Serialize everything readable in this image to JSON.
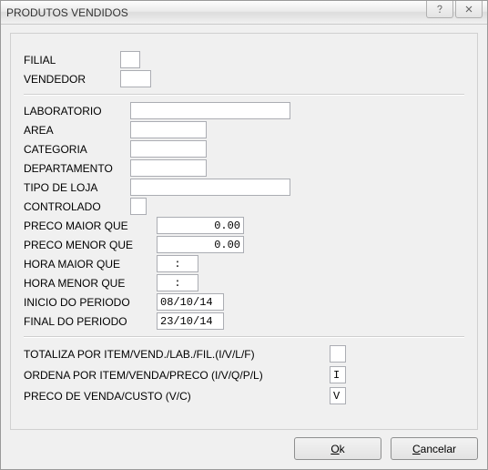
{
  "title": "PRODUTOS VENDIDOS",
  "section1": {
    "filial_label": "FILIAL",
    "filial_value": "",
    "vendedor_label": "VENDEDOR",
    "vendedor_value": ""
  },
  "section2": {
    "laboratorio_label": "LABORATORIO",
    "laboratorio_value": "",
    "area_label": "AREA",
    "area_value": "",
    "categoria_label": "CATEGORIA",
    "categoria_value": "",
    "departamento_label": "DEPARTAMENTO",
    "departamento_value": "",
    "tipo_loja_label": "TIPO DE LOJA",
    "tipo_loja_value": "",
    "controlado_label": "CONTROLADO",
    "controlado_value": "",
    "preco_maior_label": "PRECO MAIOR QUE",
    "preco_maior_value": "0.00",
    "preco_menor_label": "PRECO MENOR QUE",
    "preco_menor_value": "0.00",
    "hora_maior_label": "HORA MAIOR QUE",
    "hora_maior_value": ":",
    "hora_menor_label": "HORA MENOR QUE",
    "hora_menor_value": ":",
    "inicio_label": "INICIO DO PERIODO",
    "inicio_value": "08/10/14",
    "final_label": "FINAL DO PERIODO",
    "final_value": "23/10/14"
  },
  "section3": {
    "totaliza_label": "TOTALIZA POR ITEM/VEND./LAB./FIL.(I/V/L/F)",
    "totaliza_value": "",
    "ordena_label": "ORDENA POR ITEM/VENDA/PRECO (I/V/Q/P/L)",
    "ordena_value": "I",
    "preco_vc_label": "PRECO DE VENDA/CUSTO (V/C)",
    "preco_vc_value": "V"
  },
  "buttons": {
    "ok": "Ok",
    "cancel": "Cancelar"
  }
}
